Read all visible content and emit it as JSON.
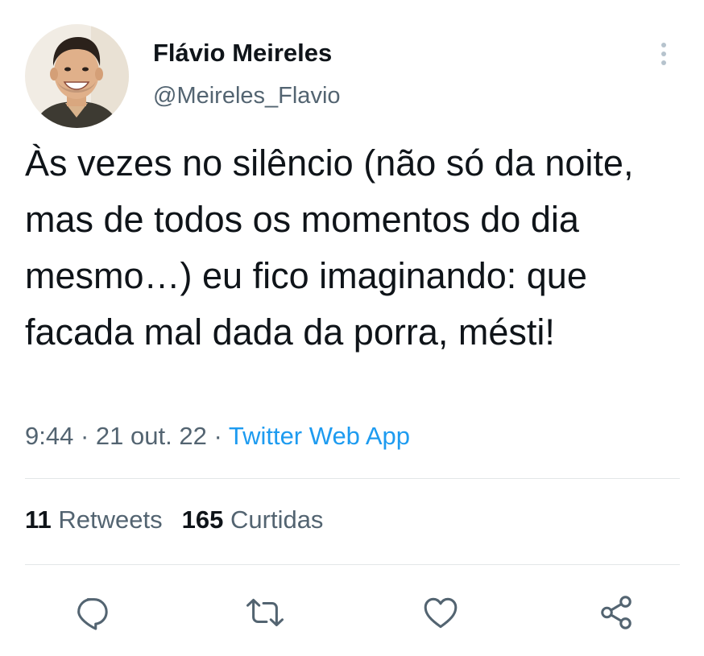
{
  "author": {
    "name": "Flávio Meireles",
    "handle": "@Meireles_Flavio"
  },
  "tweet": {
    "text": "Às vezes no silêncio (não só da noite, mas de todos os momentos do dia mesmo…) eu fico imaginando: que facada mal dada da porra, mésti!",
    "time": "9:44",
    "date": "21 out. 22",
    "separator": "·",
    "source": "Twitter Web App"
  },
  "stats": {
    "retweets_count": "11",
    "retweets_label": "Retweets",
    "likes_count": "165",
    "likes_label": "Curtidas"
  },
  "icons": {
    "more": "more-vertical-icon",
    "reply": "reply-icon",
    "retweet": "retweet-icon",
    "like": "heart-icon",
    "share": "share-icon"
  },
  "colors": {
    "text": "#0f1419",
    "secondary": "#536471",
    "link": "#1d9bf0",
    "divider": "#e3e6e8"
  }
}
